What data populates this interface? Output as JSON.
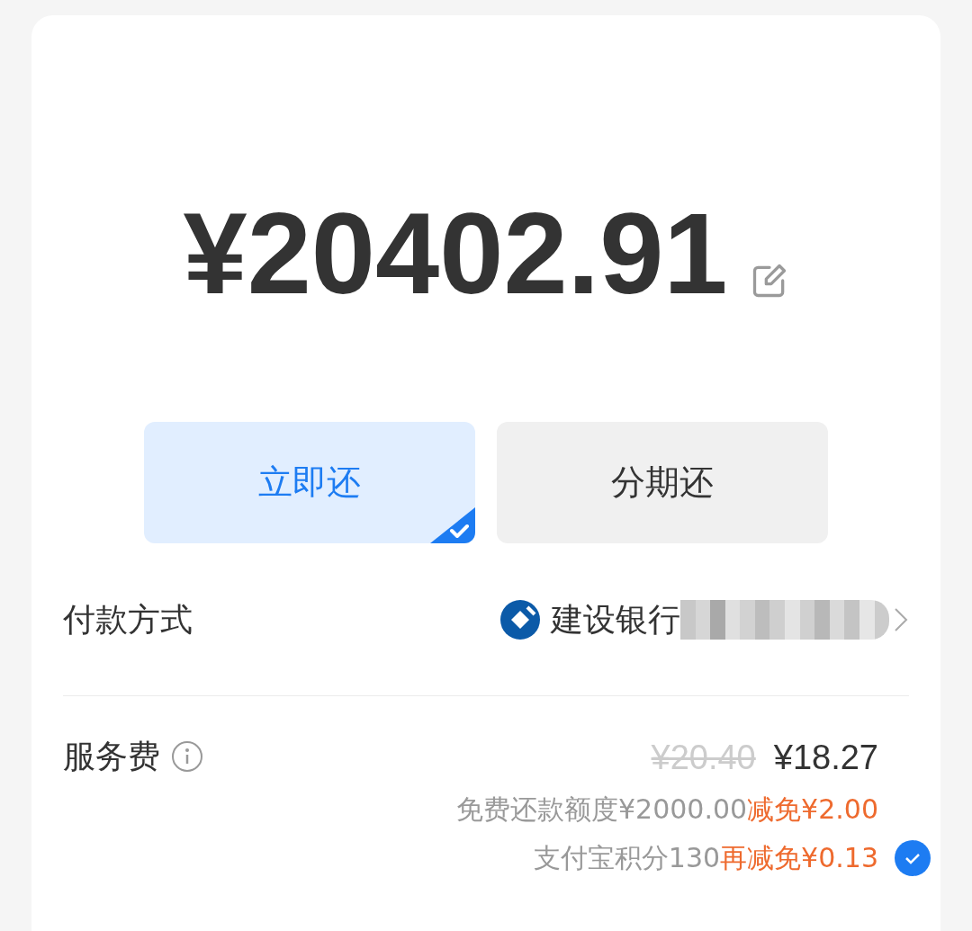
{
  "amount": "¥20402.91",
  "repay_options": [
    {
      "label": "立即还",
      "selected": true
    },
    {
      "label": "分期还",
      "selected": false
    }
  ],
  "payment": {
    "label": "付款方式",
    "bank": "建设银行"
  },
  "service_fee": {
    "label": "服务费",
    "original": "¥20.40",
    "price": "¥18.27",
    "discounts": [
      {
        "basis": "免费还款额度¥2000.00",
        "reduction": "减免¥2.00"
      },
      {
        "basis": "支付宝积分130",
        "reduction": "再减免¥0.13",
        "checked": true
      }
    ]
  }
}
